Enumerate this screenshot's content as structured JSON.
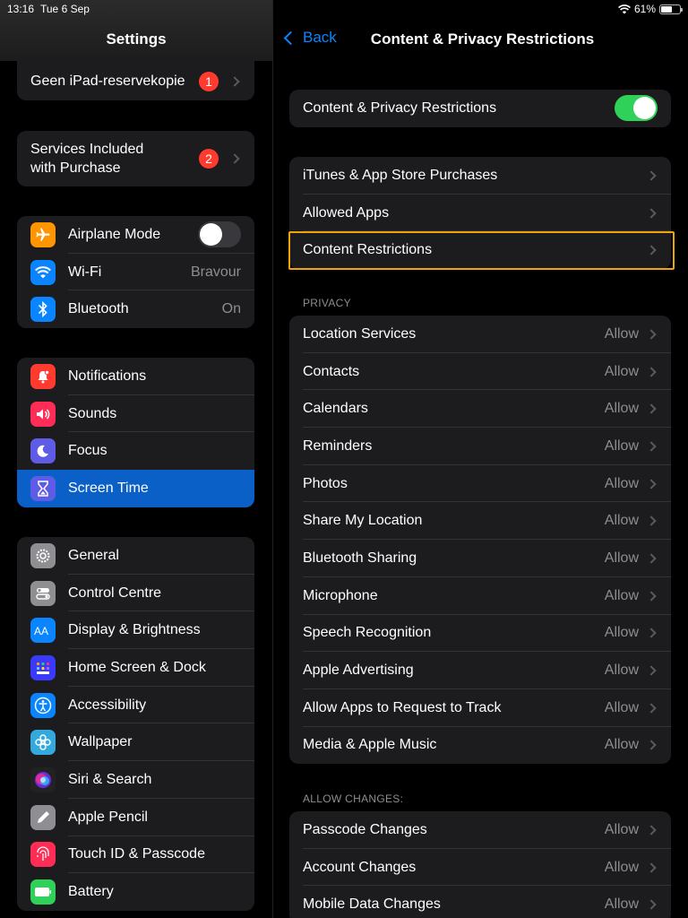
{
  "status_bar": {
    "time": "13:16",
    "date": "Tue 6 Sep",
    "battery": "61%",
    "battery_level": 0.61
  },
  "sidebar": {
    "title": "Settings",
    "group1": [
      {
        "label": "Geen iPad-reservekopie",
        "badge": "1"
      }
    ],
    "group2": [
      {
        "label_line1": "Services Included",
        "label_line2": "with Purchase",
        "badge": "2"
      }
    ],
    "connectivity": [
      {
        "label": "Airplane Mode",
        "icon": "airplane-icon",
        "color": "#ff9500",
        "toggle": "off"
      },
      {
        "label": "Wi-Fi",
        "icon": "wifi-icon",
        "color": "#0a84ff",
        "value": "Bravour"
      },
      {
        "label": "Bluetooth",
        "icon": "bluetooth-icon",
        "color": "#0a84ff",
        "value": "On"
      }
    ],
    "notifications": [
      {
        "label": "Notifications",
        "icon": "notifications-icon",
        "color": "#ff3b30"
      },
      {
        "label": "Sounds",
        "icon": "sounds-icon",
        "color": "#ff2d55"
      },
      {
        "label": "Focus",
        "icon": "focus-icon",
        "color": "#5e5ce6"
      },
      {
        "label": "Screen Time",
        "icon": "hourglass-icon",
        "color": "#5e5ce6",
        "selected": true
      }
    ],
    "general": [
      {
        "label": "General",
        "icon": "gear-icon",
        "color": "#8e8e93"
      },
      {
        "label": "Control Centre",
        "icon": "control-centre-icon",
        "color": "#8e8e93"
      },
      {
        "label": "Display & Brightness",
        "icon": "display-icon",
        "color": "#0a84ff"
      },
      {
        "label": "Home Screen & Dock",
        "icon": "home-screen-icon",
        "color": "#3a3aff"
      },
      {
        "label": "Accessibility",
        "icon": "accessibility-icon",
        "color": "#0a84ff"
      },
      {
        "label": "Wallpaper",
        "icon": "wallpaper-icon",
        "color": "#34aadc"
      },
      {
        "label": "Siri & Search",
        "icon": "siri-icon",
        "color": "#222222"
      },
      {
        "label": "Apple Pencil",
        "icon": "pencil-icon",
        "color": "#8e8e93"
      },
      {
        "label": "Touch ID & Passcode",
        "icon": "fingerprint-icon",
        "color": "#ff2d55"
      },
      {
        "label": "Battery",
        "icon": "battery-icon",
        "color": "#30d158"
      }
    ]
  },
  "detail": {
    "back_label": "Back",
    "title": "Content & Privacy Restrictions",
    "master_toggle": {
      "label": "Content & Privacy Restrictions",
      "state": "on"
    },
    "store_group": [
      {
        "label": "iTunes & App Store Purchases"
      },
      {
        "label": "Allowed Apps"
      },
      {
        "label": "Content Restrictions"
      }
    ],
    "privacy_header": "PRIVACY",
    "privacy": [
      {
        "label": "Location Services",
        "value": "Allow"
      },
      {
        "label": "Contacts",
        "value": "Allow"
      },
      {
        "label": "Calendars",
        "value": "Allow"
      },
      {
        "label": "Reminders",
        "value": "Allow"
      },
      {
        "label": "Photos",
        "value": "Allow"
      },
      {
        "label": "Share My Location",
        "value": "Allow"
      },
      {
        "label": "Bluetooth Sharing",
        "value": "Allow"
      },
      {
        "label": "Microphone",
        "value": "Allow"
      },
      {
        "label": "Speech Recognition",
        "value": "Allow"
      },
      {
        "label": "Apple Advertising",
        "value": "Allow"
      },
      {
        "label": "Allow Apps to Request to Track",
        "value": "Allow"
      },
      {
        "label": "Media & Apple Music",
        "value": "Allow"
      }
    ],
    "allow_changes_header": "ALLOW CHANGES:",
    "allow_changes": [
      {
        "label": "Passcode Changes",
        "value": "Allow"
      },
      {
        "label": "Account Changes",
        "value": "Allow"
      },
      {
        "label": "Mobile Data Changes",
        "value": "Allow"
      }
    ]
  }
}
